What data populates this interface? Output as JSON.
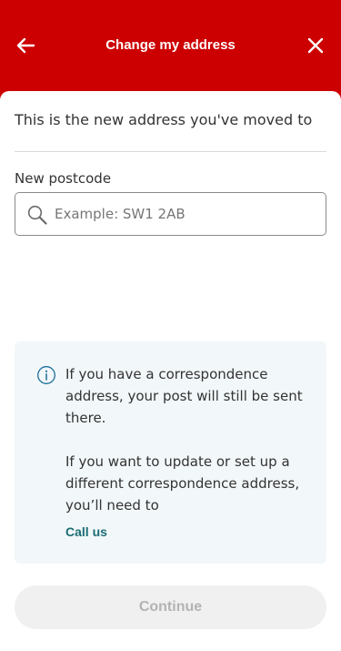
{
  "header": {
    "title": "Change my address",
    "back_icon": "arrow-left-icon",
    "close_icon": "close-icon",
    "background_color": "#cc0000"
  },
  "main": {
    "intro": "This is the new address you've moved to",
    "postcode": {
      "label": "New postcode",
      "placeholder": "Example: SW1 2AB",
      "value": "",
      "icon": "search-icon"
    },
    "info": {
      "icon": "info-icon",
      "paragraph1": "If you have a correspondence address, your post will still be sent there.",
      "paragraph2": "If you want to update or set up a different correspondence address, you’ll need to",
      "link_label": "Call us",
      "link_color": "#1a6e74",
      "background_color": "#f2f7f9"
    },
    "continue_label": "Continue",
    "continue_state": "disabled"
  }
}
